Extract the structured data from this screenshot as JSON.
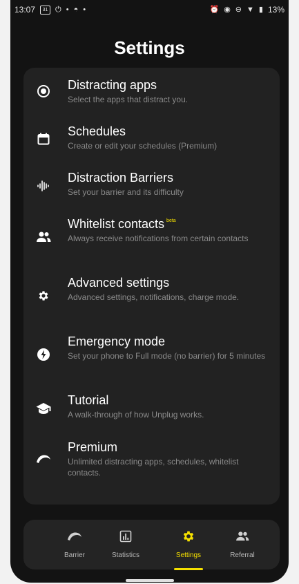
{
  "status_bar": {
    "time": "13:07",
    "calendar_day": "31",
    "battery": "13%"
  },
  "header": {
    "title": "Settings"
  },
  "settings": {
    "items": [
      {
        "icon": "radio-target-icon",
        "label": "Distracting apps",
        "desc": "Select the apps that distract you."
      },
      {
        "icon": "calendar-icon",
        "label": "Schedules",
        "desc": "Create or edit your schedules (Premium)"
      },
      {
        "icon": "barrier-waves-icon",
        "label": "Distraction Barriers",
        "desc": "Set your barrier and its difficulty"
      },
      {
        "icon": "contacts-icon",
        "label": "Whitelist contacts",
        "badge": "beta",
        "desc": "Always receive notifications from certain contacts"
      },
      {
        "icon": "gear-icon",
        "label": "Advanced settings",
        "desc": "Advanced settings, notifications, charge mode."
      },
      {
        "icon": "emergency-bolt-icon",
        "label": "Emergency mode",
        "desc": "Set your phone to Full mode (no barrier) for 5 minutes"
      },
      {
        "icon": "graduation-cap-icon",
        "label": "Tutorial",
        "desc": "A walk-through of how Unplug works."
      },
      {
        "icon": "rainbow-icon",
        "label": "Premium",
        "desc": "Unlimited distracting apps, schedules, whitelist contacts."
      }
    ]
  },
  "navbar": {
    "items": [
      {
        "icon": "rainbow-icon",
        "label": "Barrier"
      },
      {
        "icon": "statistics-icon",
        "label": "Statistics"
      },
      {
        "icon": "gear-icon",
        "label": "Settings",
        "active": true
      },
      {
        "icon": "referral-people-icon",
        "label": "Referral"
      }
    ]
  },
  "colors": {
    "background": "#131313",
    "card": "#222222",
    "accent": "#f5e000",
    "text_primary": "#ffffff",
    "text_secondary": "#8a8a8a"
  }
}
